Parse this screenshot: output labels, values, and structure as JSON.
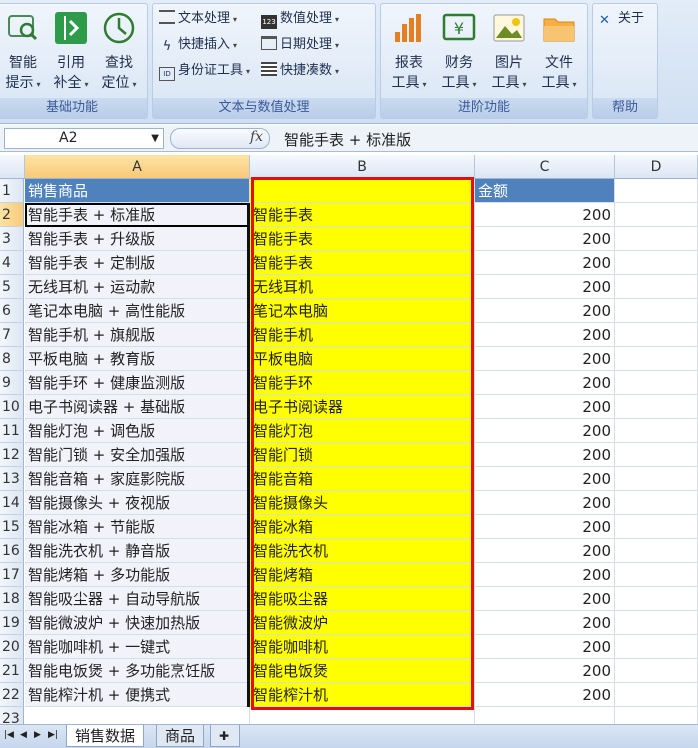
{
  "ribbon": {
    "groups": {
      "basic": "基础功能",
      "text_number": "文本与数值处理",
      "advanced": "进阶功能",
      "help": "帮助"
    },
    "basic_buttons": [
      {
        "line1": "智能",
        "line2": "提示",
        "icon": "smart-tip-icon"
      },
      {
        "line1": "引用",
        "line2": "补全",
        "icon": "reference-icon"
      },
      {
        "line1": "查找",
        "line2": "定位",
        "icon": "find-icon"
      }
    ],
    "text_buttons": [
      {
        "label": "文本处理",
        "icon": "text-process-icon"
      },
      {
        "label": "快捷插入",
        "icon": "quick-insert-icon"
      },
      {
        "label": "身份证工具",
        "icon": "id-card-icon"
      },
      {
        "label": "数值处理",
        "icon": "number-process-icon"
      },
      {
        "label": "日期处理",
        "icon": "calendar-icon"
      },
      {
        "label": "快捷凑数",
        "icon": "quick-sum-icon"
      }
    ],
    "advanced_buttons": [
      {
        "line1": "报表",
        "line2": "工具",
        "icon": "report-icon"
      },
      {
        "line1": "财务",
        "line2": "工具",
        "icon": "finance-icon"
      },
      {
        "line1": "图片",
        "line2": "工具",
        "icon": "image-icon"
      },
      {
        "line1": "文件",
        "line2": "工具",
        "icon": "folder-icon"
      }
    ],
    "about": "关于"
  },
  "formula_bar": {
    "name_box": "A2",
    "fx": "fx",
    "formula": "智能手表 + 标准版"
  },
  "columns": [
    "A",
    "B",
    "C",
    "D"
  ],
  "header_row": {
    "a": "销售商品",
    "b": "",
    "c": "金额"
  },
  "rows": [
    {
      "n": "1"
    },
    {
      "n": "2",
      "a": "智能手表 + 标准版",
      "b": "智能手表",
      "c": "200"
    },
    {
      "n": "3",
      "a": "智能手表 + 升级版",
      "b": "智能手表",
      "c": "200"
    },
    {
      "n": "4",
      "a": "智能手表 + 定制版",
      "b": "智能手表",
      "c": "200"
    },
    {
      "n": "5",
      "a": "无线耳机 + 运动款",
      "b": "无线耳机",
      "c": "200"
    },
    {
      "n": "6",
      "a": "笔记本电脑 + 高性能版",
      "b": "笔记本电脑",
      "c": "200"
    },
    {
      "n": "7",
      "a": "智能手机 + 旗舰版",
      "b": "智能手机",
      "c": "200"
    },
    {
      "n": "8",
      "a": "平板电脑 + 教育版",
      "b": "平板电脑",
      "c": "200"
    },
    {
      "n": "9",
      "a": "智能手环 + 健康监测版",
      "b": "智能手环",
      "c": "200"
    },
    {
      "n": "10",
      "a": "电子书阅读器 + 基础版",
      "b": "电子书阅读器",
      "c": "200"
    },
    {
      "n": "11",
      "a": "智能灯泡 + 调色版",
      "b": "智能灯泡",
      "c": "200"
    },
    {
      "n": "12",
      "a": "智能门锁 + 安全加强版",
      "b": "智能门锁",
      "c": "200"
    },
    {
      "n": "13",
      "a": "智能音箱 + 家庭影院版",
      "b": "智能音箱",
      "c": "200"
    },
    {
      "n": "14",
      "a": "智能摄像头 + 夜视版",
      "b": "智能摄像头",
      "c": "200"
    },
    {
      "n": "15",
      "a": "智能冰箱 + 节能版",
      "b": "智能冰箱",
      "c": "200"
    },
    {
      "n": "16",
      "a": "智能洗衣机 + 静音版",
      "b": "智能洗衣机",
      "c": "200"
    },
    {
      "n": "17",
      "a": "智能烤箱 + 多功能版",
      "b": "智能烤箱",
      "c": "200"
    },
    {
      "n": "18",
      "a": "智能吸尘器 + 自动导航版",
      "b": "智能吸尘器",
      "c": "200"
    },
    {
      "n": "19",
      "a": "智能微波炉 + 快速加热版",
      "b": "智能微波炉",
      "c": "200"
    },
    {
      "n": "20",
      "a": "智能咖啡机 + 一键式",
      "b": "智能咖啡机",
      "c": "200"
    },
    {
      "n": "21",
      "a": "智能电饭煲 + 多功能烹饪版",
      "b": "智能电饭煲",
      "c": "200"
    },
    {
      "n": "22",
      "a": "智能榨汁机 + 便携式",
      "b": "智能榨汁机",
      "c": "200"
    },
    {
      "n": "23"
    }
  ],
  "sheets": {
    "active": "销售数据",
    "other": "商品"
  },
  "colors": {
    "header_fill": "#4f81bd",
    "highlight": "#ffff00",
    "outline": "#e01010"
  }
}
